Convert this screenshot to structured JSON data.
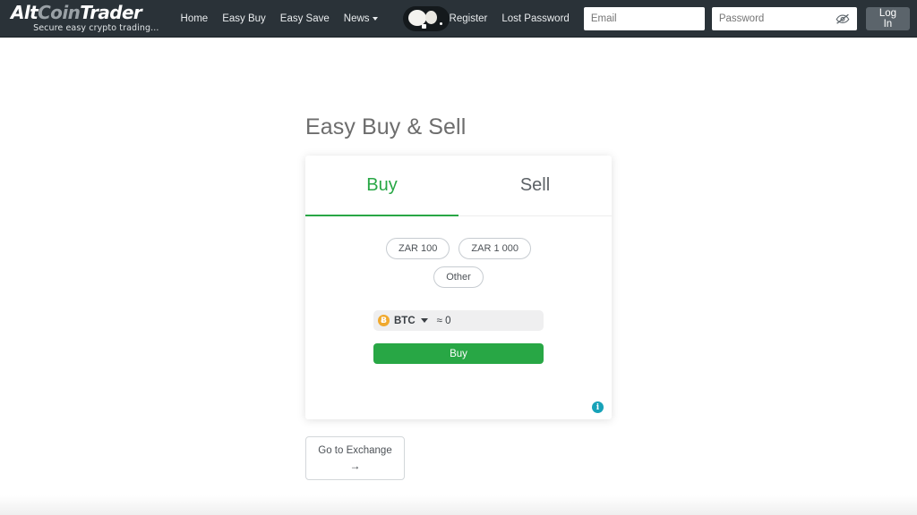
{
  "header": {
    "brand": {
      "logo_part1": "Alt",
      "logo_part2": "Coin",
      "logo_part3": "Trader",
      "tagline": "Secure easy crypto trading..."
    },
    "nav": [
      {
        "label": "Home",
        "has_caret": false
      },
      {
        "label": "Easy Buy",
        "has_caret": false
      },
      {
        "label": "Easy Save",
        "has_caret": false
      },
      {
        "label": "News",
        "has_caret": true
      }
    ],
    "badge_icon": "coins-pill-logo",
    "auth_links": [
      {
        "label": "Register"
      },
      {
        "label": "Lost Password"
      }
    ],
    "email_field": {
      "value": "",
      "placeholder": "Email"
    },
    "password_field": {
      "value": "",
      "placeholder": "Password",
      "toggle_icon": "eye-slash-icon"
    },
    "login_button": "Log In"
  },
  "main": {
    "title": "Easy Buy & Sell",
    "tabs": [
      {
        "label": "Buy",
        "active": true
      },
      {
        "label": "Sell",
        "active": false
      }
    ],
    "amount_options": [
      {
        "label": "ZAR 100"
      },
      {
        "label": "ZAR 1 000"
      },
      {
        "label": "Other"
      }
    ],
    "coin_selector": {
      "icon": "bitcoin-icon",
      "icon_glyph": "Ƀ",
      "symbol": "BTC",
      "caret": "chevron-down-icon",
      "approx_label": "≈ 0"
    },
    "primary_action": "Buy",
    "info_icon": "info-icon",
    "info_glyph": "i",
    "exchange_button": {
      "label": "Go to Exchange",
      "arrow": "→"
    }
  },
  "colors": {
    "header_bg": "#2a3238",
    "accent_green": "#28a745",
    "login_btn": "#5b646b",
    "bitcoin_orange": "#f0a92e",
    "info_teal": "#17a2b8"
  }
}
